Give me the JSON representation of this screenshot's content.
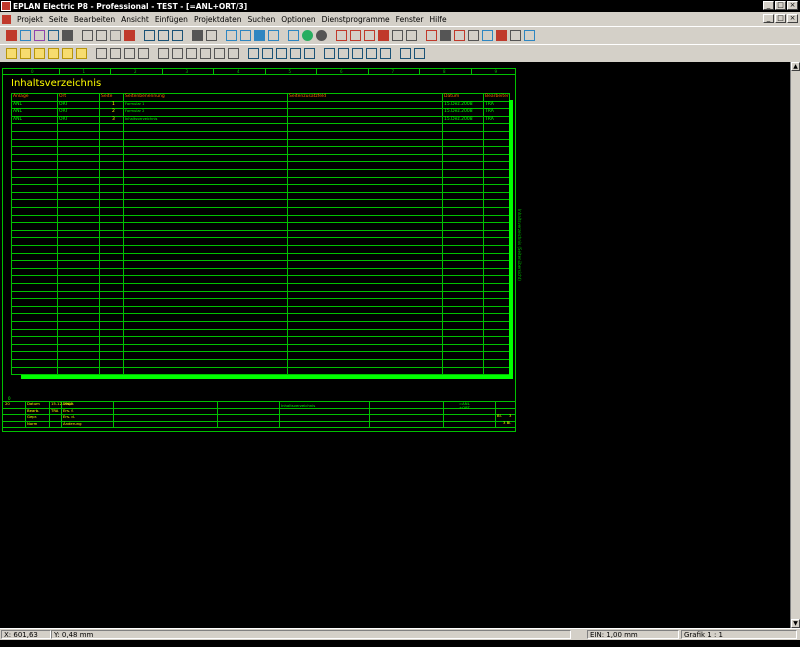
{
  "window": {
    "title": "EPLAN Electric P8 - Professional - TEST - [=ANL+ORT/3]",
    "controls": [
      "_",
      "□",
      "×"
    ]
  },
  "menubar": {
    "items": [
      "Projekt",
      "Seite",
      "Bearbeiten",
      "Ansicht",
      "Einfügen",
      "Projektdaten",
      "Suchen",
      "Optionen",
      "Dienstprogramme",
      "Fenster",
      "Hilfe"
    ]
  },
  "sheet": {
    "title": "Inhaltsverzeichnis",
    "ruler": [
      "0",
      "1",
      "2",
      "3",
      "4",
      "5",
      "6",
      "7",
      "8",
      "9"
    ],
    "columns": [
      "Anlage",
      "Ort",
      "Seite",
      "Seitenbenennung",
      "Seitenzusatzfeld",
      "Datum",
      "Bearbeiter"
    ],
    "rows": [
      [
        "ANL",
        "ORT",
        "1",
        "Formular 1",
        "",
        "15.Dez.2008",
        "TRA"
      ],
      [
        "ANL",
        "ORT",
        "2",
        "Formular 2",
        "",
        "15.Dez.2008",
        "TRA"
      ],
      [
        "ANL",
        "ORT",
        "3",
        "Inhaltsverzeichnis",
        "",
        "15.Dez.2008",
        "TRA"
      ]
    ],
    "side_label": "Inhaltsverzeichnis (Seitenübersicht)",
    "bottom_marker": "0",
    "titleblock": {
      "col0": [
        "20",
        "",
        "",
        ""
      ],
      "labels1": [
        "Datum",
        "Bearb.",
        "Gepr.",
        "Norm"
      ],
      "vals1": [
        "15.12.2008",
        "TRA",
        "",
        ""
      ],
      "labels2": [
        "Urspr.",
        "Ers. f.",
        "Ers. d.",
        "Änderung"
      ],
      "center_name": "Inhaltsverzeichnis",
      "anl_label": "=ANL",
      "ort_label": "+ORT",
      "blatt_label": "Bl.",
      "blatt_val": "3",
      "blatt_total": "3 Bl."
    }
  },
  "statusbar": {
    "x": "X: 601,63 mm",
    "y": "Y: 0,48 mm",
    "grid": "EIN: 1,00 mm",
    "scale": "Grafik 1 : 1"
  },
  "colors": {
    "background": "#000000",
    "sheet_lines": "#00c000",
    "text_green": "#00ff00",
    "text_yellow": "#ffff00",
    "header_orange": "#ff6a00",
    "chrome": "#d4d0c8"
  }
}
